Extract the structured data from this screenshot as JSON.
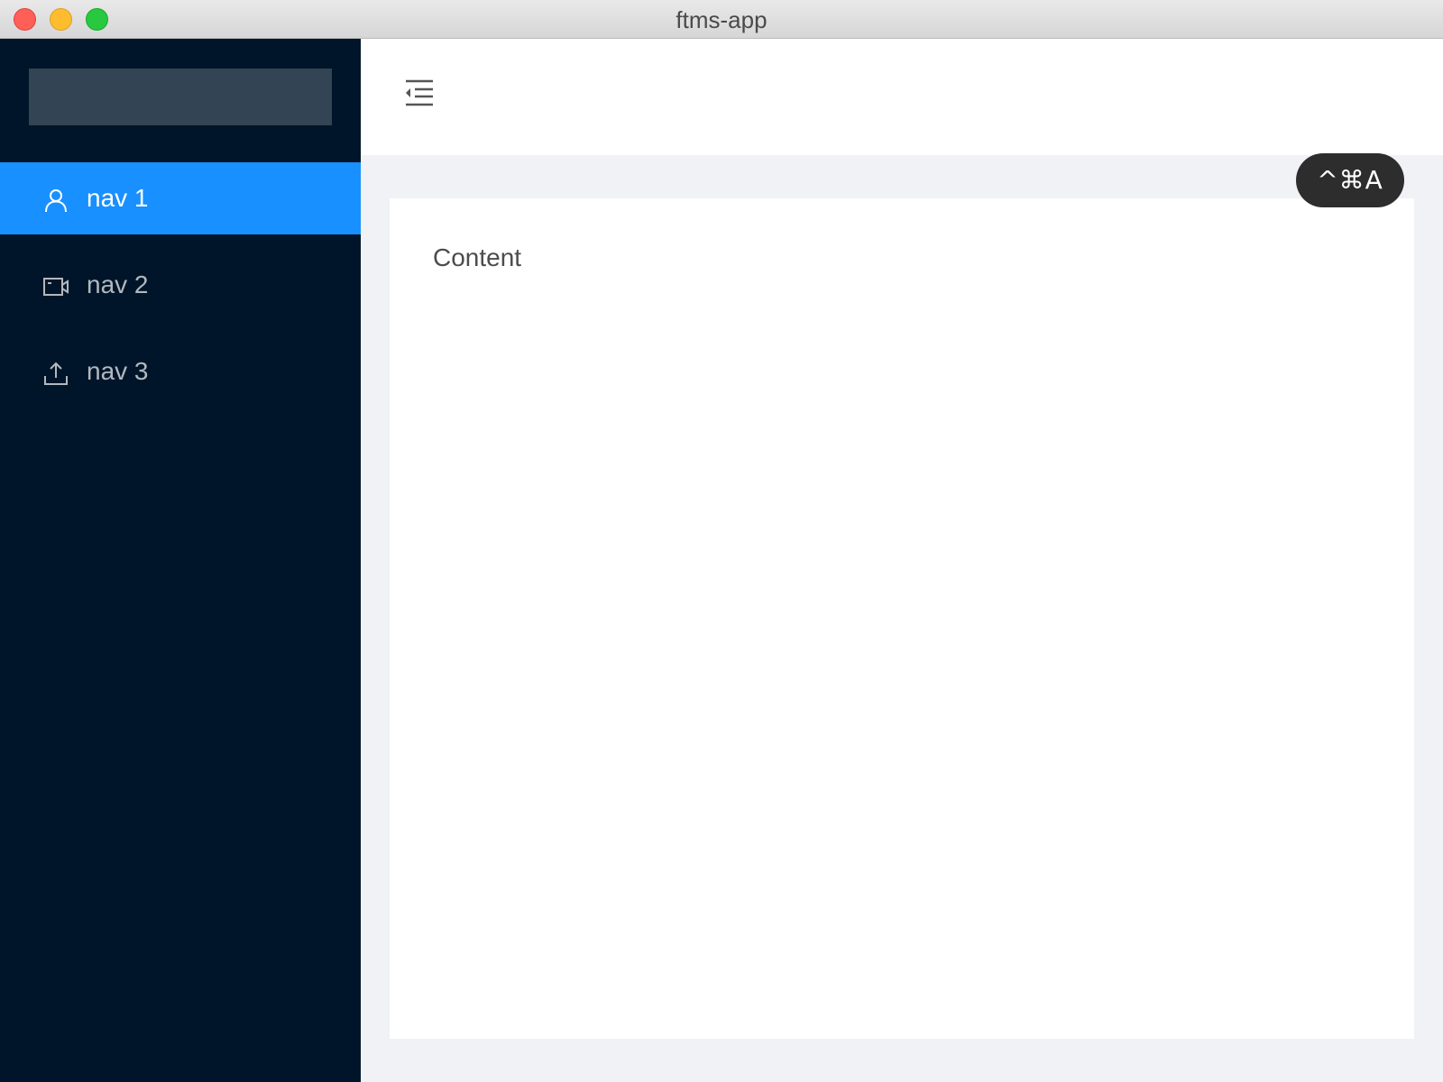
{
  "window": {
    "title": "ftms-app"
  },
  "sidebar": {
    "items": [
      {
        "label": "nav 1",
        "icon": "user-icon",
        "active": true
      },
      {
        "label": "nav 2",
        "icon": "video-camera-icon",
        "active": false
      },
      {
        "label": "nav 3",
        "icon": "upload-icon",
        "active": false
      }
    ]
  },
  "header": {
    "toggle_icon": "menu-fold-icon"
  },
  "main": {
    "content": "Content"
  },
  "overlay": {
    "shortcut": "^⌘A"
  },
  "colors": {
    "sidebar_bg": "#001529",
    "active_item": "#1890ff",
    "content_bg": "#f0f2f5"
  }
}
